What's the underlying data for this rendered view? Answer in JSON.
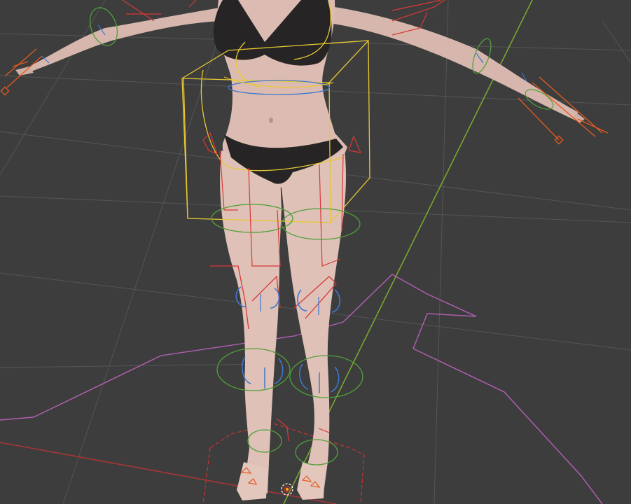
{
  "viewport": {
    "background": "#3d3d3d",
    "grid_color": "#505050",
    "axis_x_color": "#a83535",
    "axis_y_color": "#7aa52e"
  },
  "model": {
    "skin_color": "#dcbcb2",
    "skin_shadow": "#b89388",
    "garment_color": "#262424"
  },
  "rig": {
    "deform_bone_color": "#d83838",
    "ik_control_color": "#e35a20",
    "fk_ring_color": "#3f78d0",
    "pole_ring_color": "#4fa03a",
    "torso_control_color": "#e6c833",
    "root_control_color": "#b25fb5",
    "pivot_color": "#ffa500"
  }
}
